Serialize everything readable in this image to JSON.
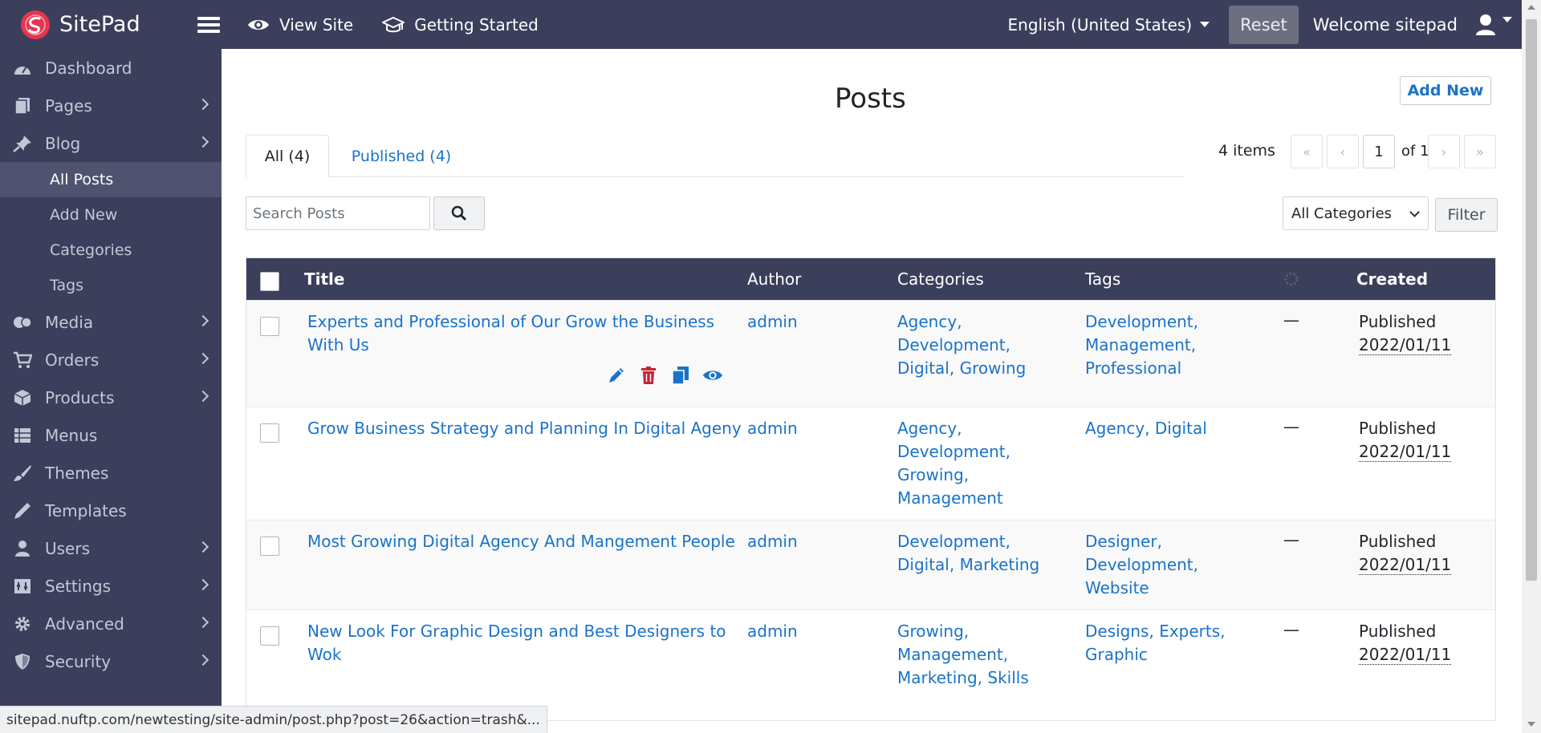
{
  "app": {
    "brand": "SitePad"
  },
  "topbar": {
    "view_site": "View Site",
    "getting_started": "Getting Started",
    "language": "English (United States)",
    "reset": "Reset",
    "welcome": "Welcome sitepad"
  },
  "sidebar": {
    "items": [
      {
        "label": "Dashboard",
        "icon": "dashboard-icon"
      },
      {
        "label": "Pages",
        "icon": "pages-icon"
      },
      {
        "label": "Blog",
        "icon": "pin-icon"
      },
      {
        "label": "Media",
        "icon": "media-icon"
      },
      {
        "label": "Orders",
        "icon": "cart-icon"
      },
      {
        "label": "Products",
        "icon": "box-icon"
      },
      {
        "label": "Menus",
        "icon": "menu-list-icon"
      },
      {
        "label": "Themes",
        "icon": "brush-icon"
      },
      {
        "label": "Templates",
        "icon": "pencil-icon"
      },
      {
        "label": "Users",
        "icon": "user-icon"
      },
      {
        "label": "Settings",
        "icon": "settings-icon"
      },
      {
        "label": "Advanced",
        "icon": "gear-icon"
      },
      {
        "label": "Security",
        "icon": "shield-icon"
      }
    ],
    "blog_sub": [
      "All Posts",
      "Add New",
      "Categories",
      "Tags"
    ]
  },
  "main": {
    "title": "Posts",
    "add_new": "Add New",
    "tabs": [
      {
        "label": "All (4)"
      },
      {
        "label": "Published (4)"
      }
    ],
    "items_count": "4 items",
    "pager": {
      "first": "«",
      "prev": "‹",
      "current": "1",
      "of": "of 1",
      "next": "›",
      "last": "»"
    },
    "search": {
      "placeholder": "Search Posts"
    },
    "category_filter": "All Categories",
    "filter": "Filter"
  },
  "table": {
    "headers": {
      "title": "Title",
      "author": "Author",
      "categories": "Categories",
      "tags": "Tags",
      "created": "Created"
    },
    "rows": [
      {
        "title_l1": "Experts and Professional of Our Grow the Business",
        "title_l2": "With Us",
        "author": "admin",
        "cats": [
          "Agency,",
          "Development,",
          "Digital, Growing"
        ],
        "tags": [
          "Development,",
          "Management,",
          "Professional"
        ],
        "comments": "—",
        "status": "Published",
        "date": "2022/01/11"
      },
      {
        "title_l1": "Grow Business Strategy and Planning In Digital Ageny",
        "author": "admin",
        "cats": [
          "Agency,",
          "Development,",
          "Growing,",
          "Management"
        ],
        "tags": [
          "Agency, Digital"
        ],
        "comments": "—",
        "status": "Published",
        "date": "2022/01/11"
      },
      {
        "title_l1": "Most Growing Digital Agency And Mangement People",
        "author": "admin",
        "cats": [
          "Development,",
          "Digital, Marketing"
        ],
        "tags": [
          "Designer,",
          "Development,",
          "Website"
        ],
        "comments": "—",
        "status": "Published",
        "date": "2022/01/11"
      },
      {
        "title_l1": "New Look For Graphic Design and Best Designers to",
        "title_l2": "Wok",
        "author": "admin",
        "cats": [
          "Growing,",
          "Management,",
          "Marketing, Skills"
        ],
        "tags": [
          "Designs, Experts,",
          "Graphic"
        ],
        "comments": "—",
        "status": "Published",
        "date": "2022/01/11"
      }
    ]
  },
  "statusbar": {
    "url": "sitepad.nuftp.com/newtesting/site-admin/post.php?post=26&action=trash&..."
  },
  "colors": {
    "sidebar_bg": "#3b3f5c",
    "link": "#1a73c9",
    "delete": "#c82333"
  }
}
